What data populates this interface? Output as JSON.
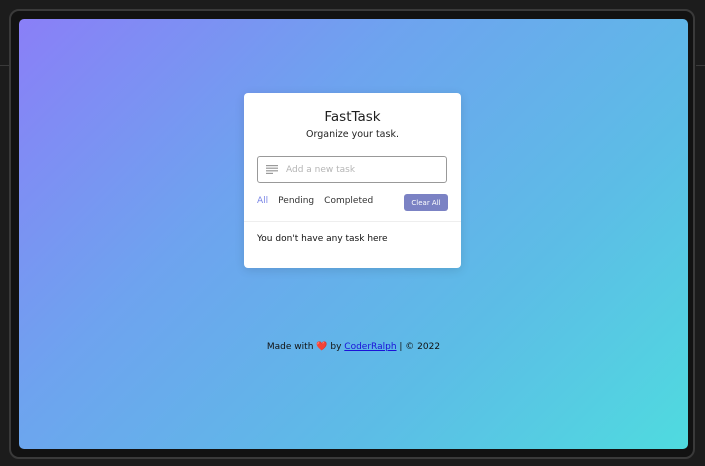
{
  "app": {
    "title": "FastTask",
    "subtitle": "Organize your task."
  },
  "task_input": {
    "placeholder": "Add a new task",
    "value": ""
  },
  "filters": {
    "all": "All",
    "pending": "Pending",
    "completed": "Completed"
  },
  "clear_all_label": "Clear All",
  "empty_message": "You don't have any task here",
  "footer": {
    "made_with": "Made with",
    "heart": "❤️",
    "by": "by",
    "author": "CoderRalph",
    "copyright": "| © 2022"
  },
  "colors": {
    "accent": "#7a86e6",
    "button": "#7b82c4",
    "gradient_start": "#8a7ff7",
    "gradient_end": "#4fdbdf"
  },
  "icons": {
    "input_icon": "notes-icon"
  }
}
